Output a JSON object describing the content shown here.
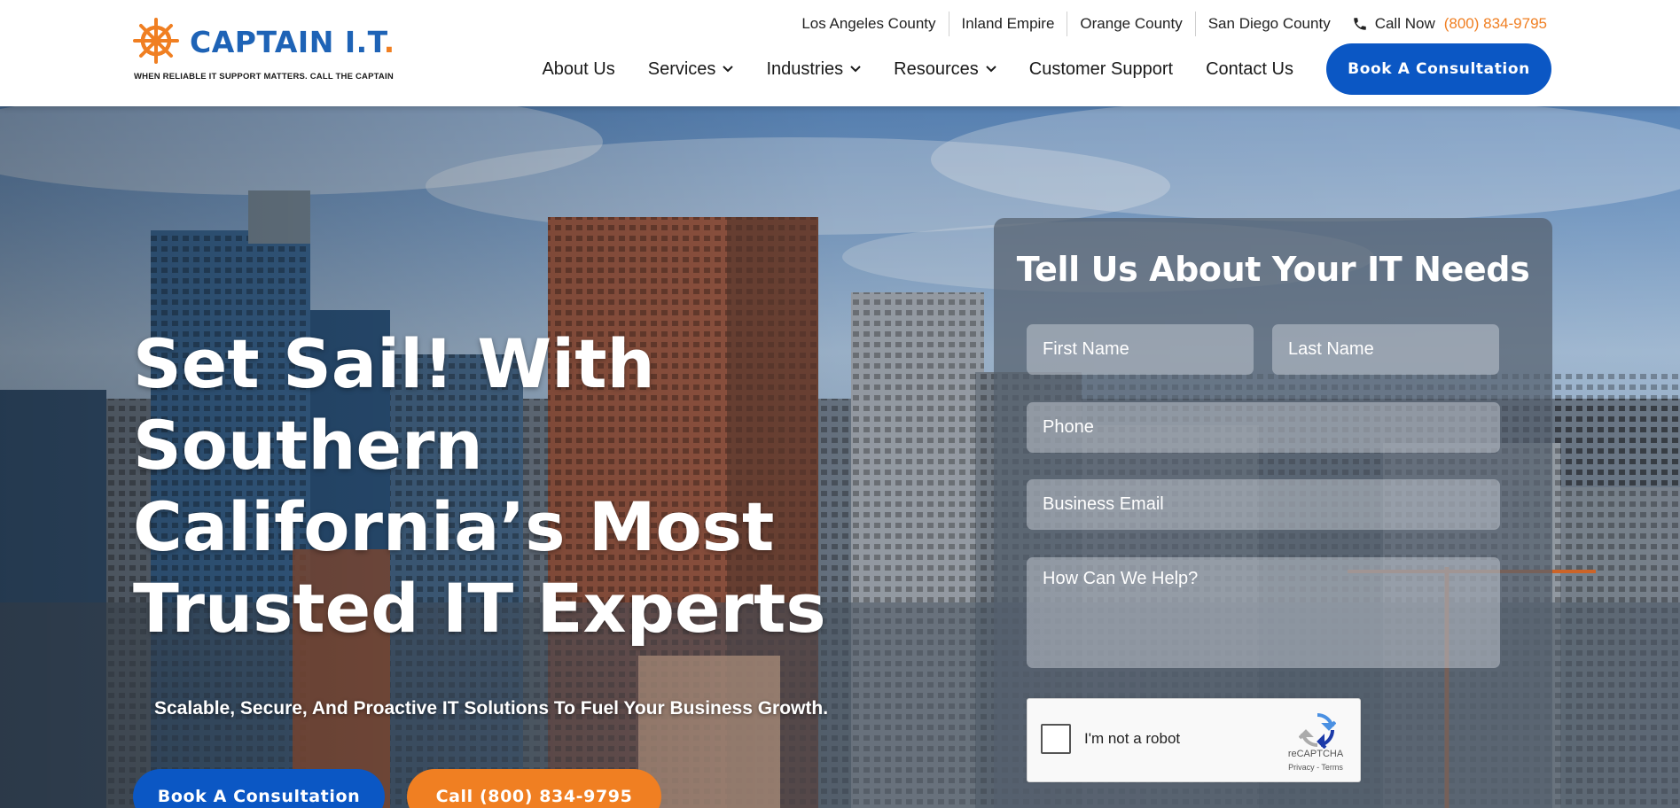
{
  "brand": {
    "name": "CAPTAIN I.T.",
    "name_main": "CAPTAIN I.T",
    "name_dot": ".",
    "tagline": "WHEN RELIABLE IT SUPPORT MATTERS. CALL THE CAPTAIN",
    "logo_icon": "ship-wheel-icon",
    "colors": {
      "blue": "#1e63b6",
      "orange": "#f07f22",
      "button_blue": "#0b57c4"
    }
  },
  "topbar": {
    "counties": [
      "Los Angeles County",
      "Inland Empire",
      "Orange County",
      "San Diego County"
    ],
    "call_label": "Call Now",
    "call_number": "(800) 834-9795",
    "call_icon": "phone-icon"
  },
  "nav": {
    "items": [
      {
        "label": "About Us",
        "dropdown": false
      },
      {
        "label": "Services",
        "dropdown": true
      },
      {
        "label": "Industries",
        "dropdown": true
      },
      {
        "label": "Resources",
        "dropdown": true
      },
      {
        "label": "Customer Support",
        "dropdown": false
      },
      {
        "label": "Contact Us",
        "dropdown": false
      }
    ],
    "cta_label": "Book A Consultation"
  },
  "hero": {
    "title": "Set Sail! With Southern California’s Most Trusted IT Experts",
    "subtitle": "Scalable, Secure, And Proactive IT Solutions To Fuel Your Business Growth.",
    "cta_consult": "Book A Consultation",
    "cta_call": "Call (800) 834-9795"
  },
  "form": {
    "title": "Tell Us About Your IT Needs",
    "first_name_placeholder": "First Name",
    "last_name_placeholder": "Last Name",
    "phone_placeholder": "Phone",
    "email_placeholder": "Business Email",
    "help_placeholder": "How Can We Help?",
    "captcha_label": "I'm not a robot",
    "captcha_brand": "reCAPTCHA",
    "captcha_links": "Privacy - Terms"
  }
}
